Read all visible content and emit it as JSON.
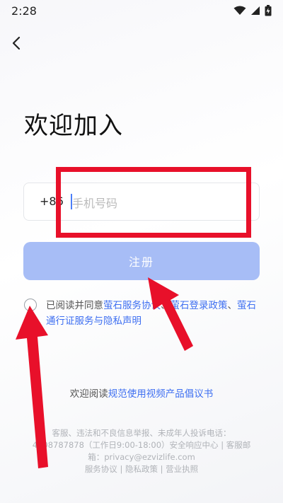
{
  "status_bar": {
    "time": "2:28"
  },
  "page": {
    "title": "欢迎加入"
  },
  "phone": {
    "country_code": "+86",
    "placeholder": "手机号码"
  },
  "register": {
    "label": "注册"
  },
  "agreement": {
    "prefix": "已阅读并同意",
    "link1": "萤石服务协议",
    "sep1": "、",
    "link2": "萤石登录政策",
    "sep2": "、",
    "link3": "萤石通行证服务与隐私声明"
  },
  "initiative": {
    "prefix": "欢迎阅读",
    "link": "规范使用视频产品倡议书"
  },
  "footer": {
    "line1": "客服、违法和不良信息举报、未成年人投诉电话：",
    "line2": "4008787878（工作日9:00-18:00）安全响应中心 | 客服邮",
    "line3": "箱：privacy@ezvizlife.com",
    "line4": "服务协议 | 隐私政策 | 营业执照"
  },
  "colors": {
    "accent": "#3e6ff1",
    "button": "#a7bdf6",
    "annotation": "#e8102a"
  },
  "icons": [
    "back-chevron-icon",
    "wifi-icon",
    "signal-icon",
    "battery-icon"
  ]
}
